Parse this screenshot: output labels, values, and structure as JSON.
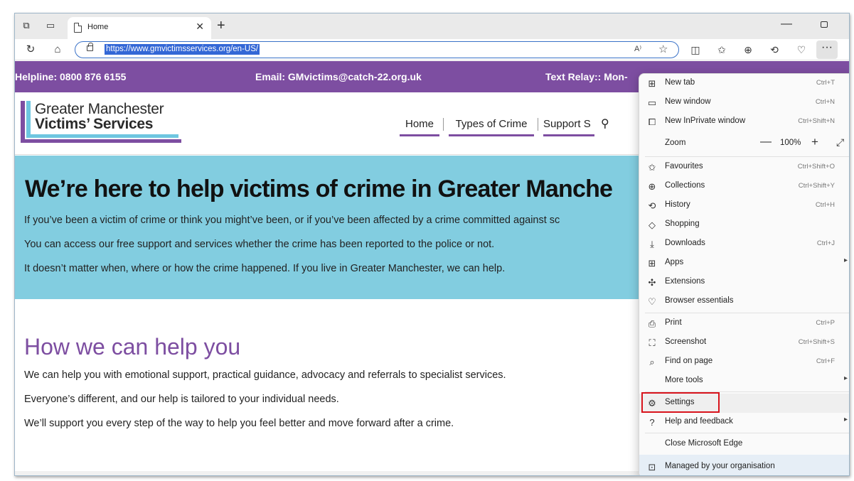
{
  "browser": {
    "tab_title": "Home",
    "tab_close": "✕",
    "new_tab": "+",
    "url": "https://www.gmvictimsservices.org/en-US/",
    "read_aloud": "A⁾",
    "more_button": "···"
  },
  "site": {
    "topbar": {
      "helpline": "Helpline: 0800 876 6155",
      "email": "Email: GMvictims@catch-22.org.uk",
      "relay": "Text Relay:: Mon-"
    },
    "logo": {
      "line1": "Greater Manchester",
      "line2": "Victims’ Services"
    },
    "nav": [
      "Home",
      "Types of Crime",
      "Support S"
    ],
    "hero": {
      "title": "We’re here to help victims of crime in Greater Manche",
      "p1": "If you’ve been a victim of crime or think you might’ve been, or if you’ve been affected by a crime committed against sc",
      "p2": "You can access our free support and services whether the crime has been reported to the police or not.",
      "p3": "It doesn’t matter when, where or how the crime happened. If you live in Greater Manchester, we can help."
    },
    "help": {
      "title": "How we can help you",
      "p1": "We can help you with emotional support, practical guidance, advocacy and referrals to specialist services.",
      "p2": "Everyone’s different, and our help is tailored to your individual needs.",
      "p3": "We’ll support you every step of the way to help you feel better and move forward after a crime."
    }
  },
  "menu": {
    "items": [
      {
        "label": "New tab",
        "shortcut": "Ctrl+T",
        "icon": "new-tab-icon"
      },
      {
        "label": "New window",
        "shortcut": "Ctrl+N",
        "icon": "new-window-icon"
      },
      {
        "label": "New InPrivate window",
        "shortcut": "Ctrl+Shift+N",
        "icon": "inprivate-icon"
      },
      {
        "label": "Zoom",
        "value": "100%"
      },
      {
        "label": "Favourites",
        "shortcut": "Ctrl+Shift+O",
        "icon": "favourites-icon"
      },
      {
        "label": "Collections",
        "shortcut": "Ctrl+Shift+Y",
        "icon": "collections-icon"
      },
      {
        "label": "History",
        "shortcut": "Ctrl+H",
        "icon": "history-icon"
      },
      {
        "label": "Shopping",
        "shortcut": "",
        "icon": "shopping-icon"
      },
      {
        "label": "Downloads",
        "shortcut": "Ctrl+J",
        "icon": "downloads-icon"
      },
      {
        "label": "Apps",
        "shortcut": "",
        "icon": "apps-icon"
      },
      {
        "label": "Extensions",
        "shortcut": "",
        "icon": "extensions-icon"
      },
      {
        "label": "Browser essentials",
        "shortcut": "",
        "icon": "browser-essentials-icon"
      },
      {
        "label": "Print",
        "shortcut": "Ctrl+P",
        "icon": "print-icon"
      },
      {
        "label": "Screenshot",
        "shortcut": "Ctrl+Shift+S",
        "icon": "screenshot-icon"
      },
      {
        "label": "Find on page",
        "shortcut": "Ctrl+F",
        "icon": "find-icon"
      },
      {
        "label": "More tools",
        "shortcut": ""
      },
      {
        "label": "Settings",
        "shortcut": "",
        "icon": "settings-icon"
      },
      {
        "label": "Help and feedback",
        "shortcut": "",
        "icon": "help-icon"
      },
      {
        "label": "Close Microsoft Edge",
        "shortcut": ""
      },
      {
        "label": "Managed by your organisation",
        "shortcut": "",
        "icon": "briefcase-icon"
      }
    ],
    "highlight_color": "#d8141c"
  },
  "colors": {
    "brand_purple": "#7d4ea1",
    "brand_blue": "#82cde0",
    "url_select": "#3367d6"
  }
}
